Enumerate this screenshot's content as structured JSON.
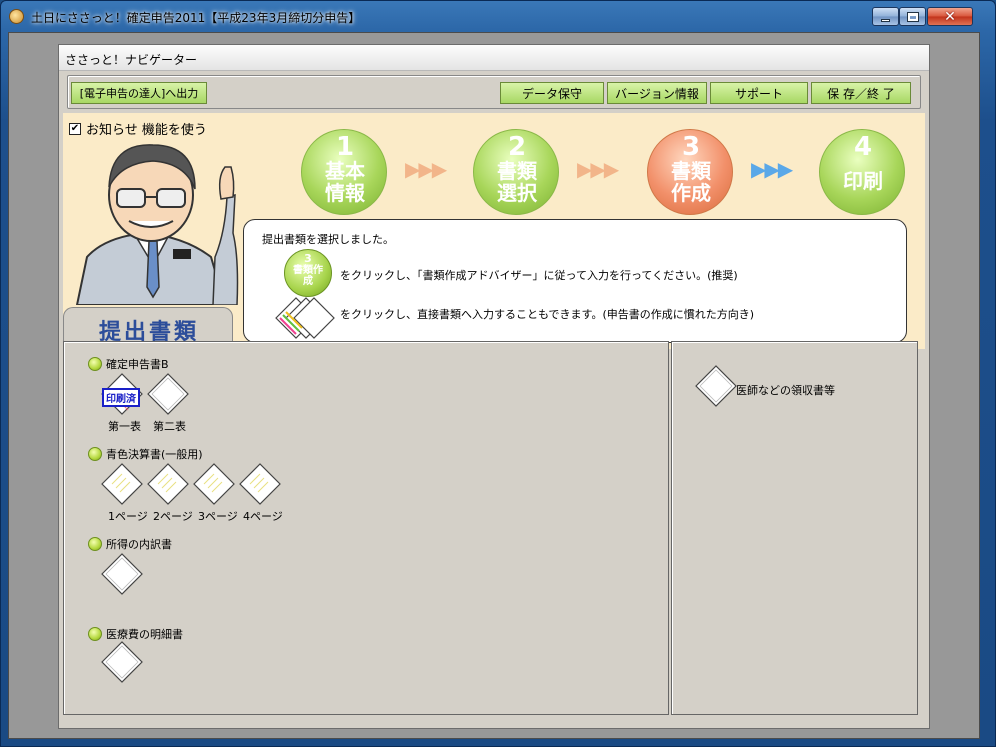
{
  "window": {
    "title": "土日にささっと！確定申告2011【平成23年3月締切分申告】"
  },
  "navigator": {
    "title": "ささっと！ナビゲーター",
    "toolbar": {
      "export_label": "[電子申告の達人]へ出力",
      "save_data_label": "データ保守",
      "version_label": "バージョン情報",
      "support_label": "サポート",
      "save_exit_label": "保 存／終 了"
    },
    "notify_checkbox": {
      "label": "お知らせ 機能を使う",
      "checked": true
    },
    "steps": [
      {
        "number": "1",
        "label": "基本情報",
        "state": "done"
      },
      {
        "number": "2",
        "label": "書類選択",
        "state": "done"
      },
      {
        "number": "3",
        "label": "書類作成",
        "state": "current"
      },
      {
        "number": "4",
        "label": "印刷",
        "state": "next"
      }
    ],
    "balloon": {
      "line1": "提出書類を選択しました。",
      "line2": "をクリックし、「書類作成アドバイザー」に従って入力を行ってください。(推奨)",
      "line3": "をクリックし、直接書類へ入力することもできます。(申告書の作成に慣れた方向き)",
      "icon_number": "3",
      "icon_label": "書類作成"
    },
    "panel_title": "提出書類",
    "sections": [
      {
        "title": "確定申告書B",
        "docs": [
          "第一表",
          "第二表"
        ],
        "stamp": "印刷済"
      },
      {
        "title": "青色決算書(一般用)",
        "docs": [
          "1ページ",
          "2ページ",
          "3ページ",
          "4ページ"
        ]
      },
      {
        "title": "所得の内訳書",
        "docs": [
          ""
        ]
      },
      {
        "title": "医療費の明細書",
        "docs": [
          ""
        ]
      }
    ],
    "right_panel": {
      "item_label": "医師などの領収書等"
    }
  },
  "colors": {
    "toolbar_button": "#b8e070",
    "step_done": "#9ccc40",
    "step_current": "#f09060",
    "balloon_border": "#333333",
    "panel_title": "#2c4d9a"
  }
}
